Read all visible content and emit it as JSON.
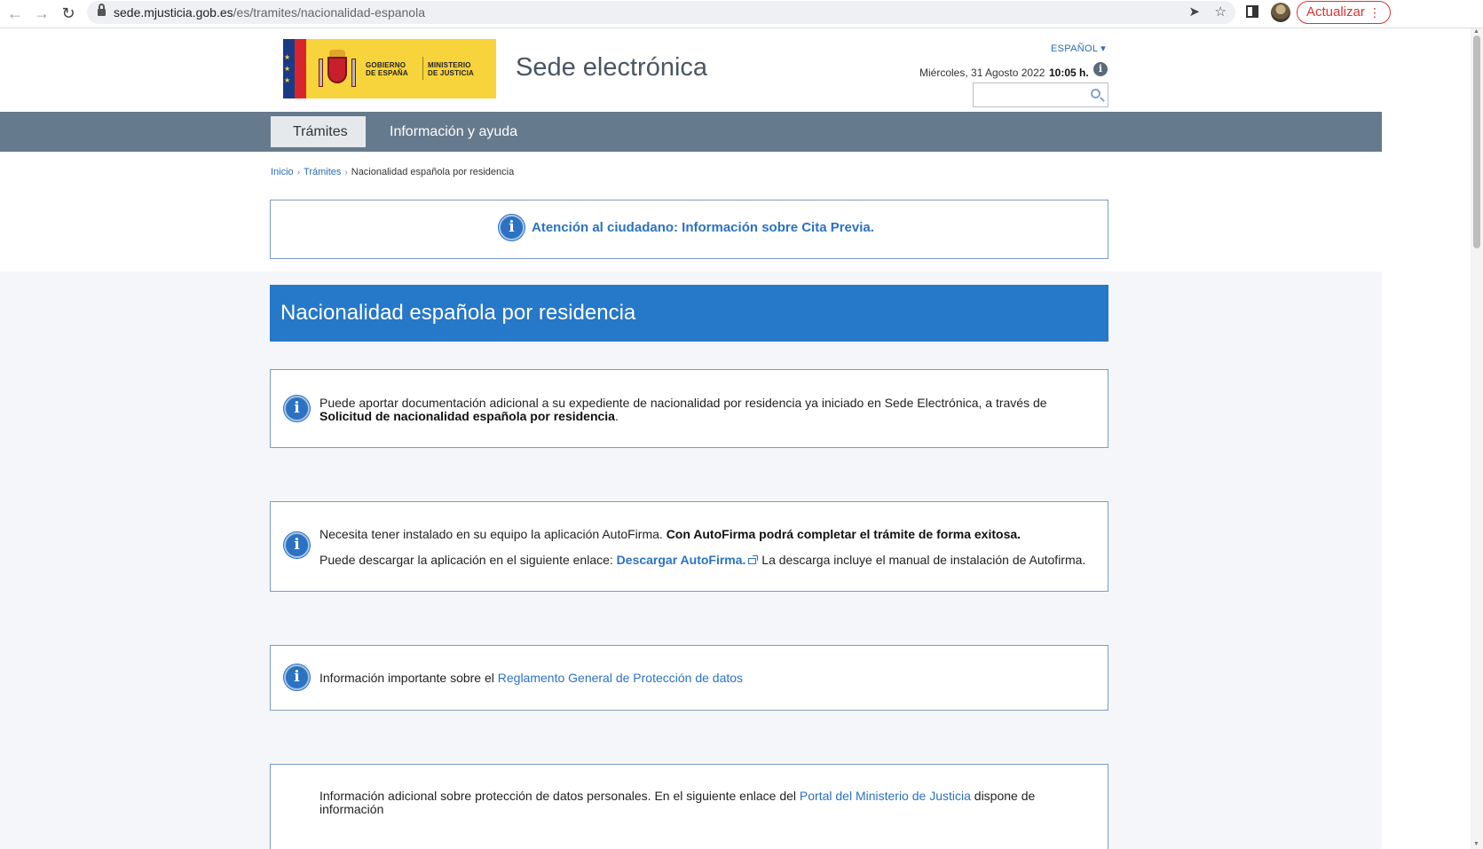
{
  "browser": {
    "url_domain": "sede.mjusticia.gob.es",
    "url_path": "/es/tramites/nacionalidad-espanola",
    "update_label": "Actualizar",
    "update_dots": "⋮"
  },
  "header": {
    "logo_left_line1": "GOBIERNO",
    "logo_left_line2": "DE ESPAÑA",
    "logo_right_line1": "MINISTERIO",
    "logo_right_line2": "DE JUSTICIA",
    "site_title": "Sede electrónica",
    "language": "ESPAÑOL ▾",
    "date": "Miércoles, 31 Agosto 2022",
    "time": "10:05 h.",
    "info_glyph": "i",
    "search_placeholder": ""
  },
  "menu": {
    "items": [
      {
        "label": "Trámites",
        "active": true
      },
      {
        "label": "Información y ayuda",
        "active": false
      }
    ]
  },
  "breadcrumb": {
    "items": [
      "Inicio",
      "Trámites"
    ],
    "current": "Nacionalidad española por residencia",
    "separator": "›"
  },
  "notice": {
    "text": "Atención al ciudadano: Información sobre Cita Previa."
  },
  "page_title": "Nacionalidad española por residencia",
  "boxes": {
    "box1": {
      "text": "Puede aportar documentación adicional a su expediente de nacionalidad por residencia ya iniciado en Sede Electrónica, a través de ",
      "bold": "Solicitud de nacionalidad española por residencia",
      "end": "."
    },
    "box2": {
      "line1_text": "Necesita tener instalado en su equipo la aplicación AutoFirma. ",
      "line1_bold": "Con AutoFirma podrá completar el trámite de forma exitosa.",
      "line2_text": "Puede descargar la aplicación en el siguiente enlace: ",
      "line2_link": "Descargar AutoFirma.",
      "line2_end": " La descarga incluye el manual de instalación de Autofirma."
    },
    "box3": {
      "text": "Información importante sobre el ",
      "link": "Reglamento General de Protección de datos"
    },
    "box4": {
      "text": "Información adicional sobre protección de datos personales. En el siguiente enlace del ",
      "link": "Portal del Ministerio de Justicia",
      "end": " dispone de información"
    }
  },
  "icons": {
    "info": "i"
  },
  "colors": {
    "primary_blue": "#2678c8",
    "menu_bar": "#667a8d",
    "logo_yellow": "#f7d33c"
  }
}
